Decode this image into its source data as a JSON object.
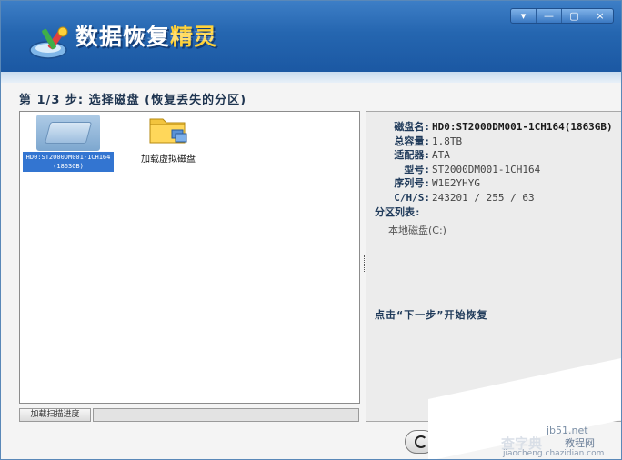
{
  "app": {
    "title_main": "数据恢复",
    "title_highlight": "精灵"
  },
  "window_controls": [
    "▾",
    "—",
    "▢",
    "×"
  ],
  "step_title": "第 1/3 步: 选择磁盘 (恢复丢失的分区)",
  "disks": [
    {
      "label": "HD0:ST2000DM001-1CH164(1863GB)",
      "selected": true
    }
  ],
  "virtual_disk": {
    "label": "加载虚拟磁盘"
  },
  "disk_info": {
    "rows": [
      {
        "label": "磁盘名:",
        "value": "HD0:ST2000DM001-1CH164(1863GB)"
      },
      {
        "label": "总容量:",
        "value": "1.8TB"
      },
      {
        "label": "适配器:",
        "value": "ATA"
      },
      {
        "label": "型号:",
        "value": "ST2000DM001-1CH164"
      },
      {
        "label": "序列号:",
        "value": "W1E2YHYG"
      },
      {
        "label": "C/H/S:",
        "value": "243201 / 255 / 63"
      }
    ],
    "partition_title": "分区列表:",
    "partitions": [
      "本地磁盘(C:)"
    ],
    "hint": "点击“下一步”开始恢复"
  },
  "scan_progress_label": "加载扫描进度",
  "watermark": {
    "line1": "jb51.net",
    "line2": "查字典",
    "line3": "教程网",
    "line4": "jiaocheng.chazidian.com"
  },
  "colors": {
    "header": "#2566b0",
    "selection": "#3375d1",
    "title_highlight": "#ffd23a"
  }
}
